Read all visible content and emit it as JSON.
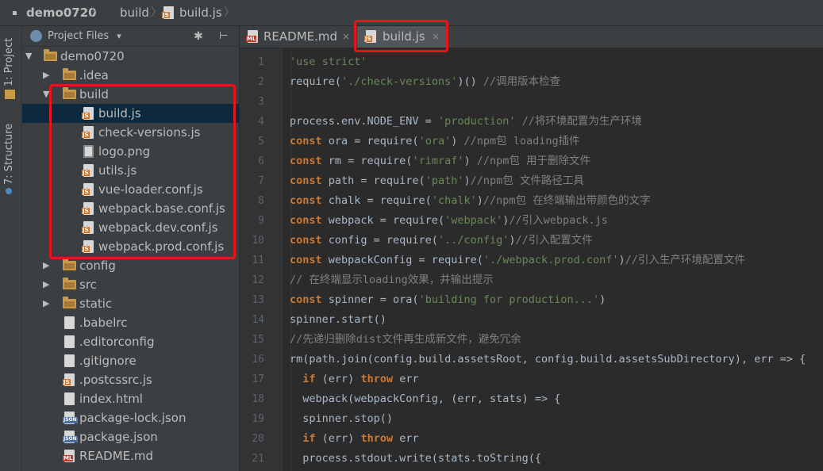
{
  "breadcrumb": {
    "project": "demo0720",
    "folder": "build",
    "file": "build.js"
  },
  "side_tabs": {
    "project": "1: Project",
    "structure": "7: Structure"
  },
  "project_panel": {
    "title": "Project Files"
  },
  "tree": {
    "root": "demo0720",
    "idea": ".idea",
    "build": "build",
    "build_children": [
      "build.js",
      "check-versions.js",
      "logo.png",
      "utils.js",
      "vue-loader.conf.js",
      "webpack.base.conf.js",
      "webpack.dev.conf.js",
      "webpack.prod.conf.js"
    ],
    "config": "config",
    "src": "src",
    "static": "static",
    "files": [
      ".babelrc",
      ".editorconfig",
      ".gitignore",
      ".postcssrc.js",
      "index.html",
      "package-lock.json",
      "package.json",
      "README.md"
    ]
  },
  "icon_tags": {
    "js": "JS",
    "json": "JSON",
    "md": "ML"
  },
  "tabs": [
    {
      "label": "README.md",
      "close": "×"
    },
    {
      "label": "build.js",
      "close": "×"
    }
  ],
  "glyphs": {
    "arrow_down": "▼",
    "arrow_right": "▶",
    "caret": "▾",
    "sep": "〉",
    "gear": "✱",
    "collapse": "⊢"
  },
  "colors": {
    "highlight": "#e8141b",
    "keyword": "#cc7832",
    "string": "#6a8759",
    "comment": "#808080",
    "selected_row": "#0d293e"
  },
  "code_lines": [
    [
      [
        "str",
        "'use strict'"
      ]
    ],
    [
      [
        "t",
        "require("
      ],
      [
        "str",
        "'./check-versions'"
      ],
      [
        "t",
        ")() "
      ],
      [
        "cmt",
        "//调用版本检查"
      ]
    ],
    [],
    [
      [
        "t",
        "process.env.NODE_ENV = "
      ],
      [
        "str",
        "'production'"
      ],
      [
        "t",
        " "
      ],
      [
        "cmt",
        "//将环境配置为生产环境"
      ]
    ],
    [
      [
        "kw",
        "const"
      ],
      [
        "t",
        " ora = require("
      ],
      [
        "str",
        "'ora'"
      ],
      [
        "t",
        ") "
      ],
      [
        "cmt",
        "//npm包 loading插件"
      ]
    ],
    [
      [
        "kw",
        "const"
      ],
      [
        "t",
        " rm = require("
      ],
      [
        "str",
        "'rimraf'"
      ],
      [
        "t",
        ") "
      ],
      [
        "cmt",
        "//npm包 用于删除文件"
      ]
    ],
    [
      [
        "kw",
        "const"
      ],
      [
        "t",
        " path = require("
      ],
      [
        "str",
        "'path'"
      ],
      [
        "t",
        ")"
      ],
      [
        "cmt",
        "//npm包 文件路径工具"
      ]
    ],
    [
      [
        "kw",
        "const"
      ],
      [
        "t",
        " chalk = require("
      ],
      [
        "str",
        "'chalk'"
      ],
      [
        "t",
        ")"
      ],
      [
        "cmt",
        "//npm包 在终端输出带颜色的文字"
      ]
    ],
    [
      [
        "kw",
        "const"
      ],
      [
        "t",
        " webpack = require("
      ],
      [
        "str",
        "'webpack'"
      ],
      [
        "t",
        ")"
      ],
      [
        "cmt",
        "//引入webpack.js"
      ]
    ],
    [
      [
        "kw",
        "const"
      ],
      [
        "t",
        " config = require("
      ],
      [
        "str",
        "'../config'"
      ],
      [
        "t",
        ")"
      ],
      [
        "cmt",
        "//引入配置文件"
      ]
    ],
    [
      [
        "kw",
        "const"
      ],
      [
        "t",
        " webpackConfig = require("
      ],
      [
        "str",
        "'./webpack.prod.conf'"
      ],
      [
        "t",
        ")"
      ],
      [
        "cmt",
        "//引入生产环境配置文件"
      ]
    ],
    [
      [
        "cmt",
        "// 在终端显示loading效果，并输出提示"
      ]
    ],
    [
      [
        "kw",
        "const"
      ],
      [
        "t",
        " spinner = ora("
      ],
      [
        "str",
        "'building for production...'"
      ],
      [
        "t",
        ")"
      ]
    ],
    [
      [
        "t",
        "spinner.start()"
      ]
    ],
    [
      [
        "cmt",
        "//先递归删除dist文件再生成新文件，避免冗余"
      ]
    ],
    [
      [
        "t",
        "rm(path.join(config.build.assetsRoot, config.build.assetsSubDirectory), err => {"
      ]
    ],
    [
      [
        "t",
        "  "
      ],
      [
        "kw",
        "if"
      ],
      [
        "t",
        " (err) "
      ],
      [
        "kw",
        "throw"
      ],
      [
        "t",
        " err"
      ]
    ],
    [
      [
        "t",
        "  webpack(webpackConfig, (err, stats) => {"
      ]
    ],
    [
      [
        "t",
        "  spinner.stop()"
      ]
    ],
    [
      [
        "t",
        "  "
      ],
      [
        "kw",
        "if"
      ],
      [
        "t",
        " (err) "
      ],
      [
        "kw",
        "throw"
      ],
      [
        "t",
        " err"
      ]
    ],
    [
      [
        "t",
        "  process.stdout.write(stats.toString({"
      ]
    ]
  ]
}
